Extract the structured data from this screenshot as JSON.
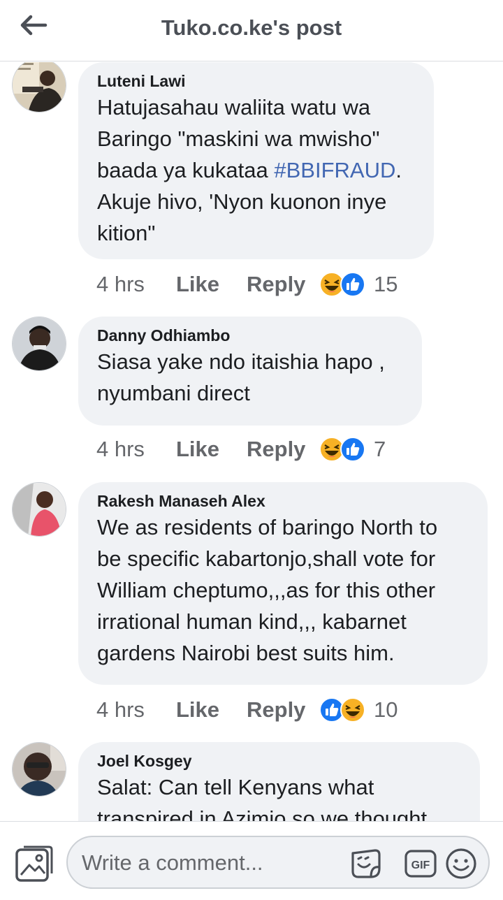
{
  "header": {
    "title": "Tuko.co.ke's post"
  },
  "comments": [
    {
      "author": "Luteni Lawi",
      "text_before": "Hatujasahau waliita watu wa\nBaringo \"maskini wa mwisho\"\nbaada ya kukataa ",
      "hashtag": "#BBIFRAUD",
      "text_after": ".\nAkuje hivo, 'Nyon kuonon inye\nkition\"",
      "time": "4 hrs",
      "like_label": "Like",
      "reply_label": "Reply",
      "reactions": [
        "haha",
        "like"
      ],
      "reaction_count": "15"
    },
    {
      "author": "Danny Odhiambo",
      "text": "Siasa yake ndo itaishia hapo ,\nnyumbani direct",
      "time": "4 hrs",
      "like_label": "Like",
      "reply_label": "Reply",
      "reactions": [
        "haha",
        "like"
      ],
      "reaction_count": "7"
    },
    {
      "author": "Rakesh Manaseh Alex",
      "text": "We as residents of baringo North to\nbe specific kabartonjo,shall vote for\nWilliam cheptumo,,,as for this other\nirrational human kind,,, kabarnet\ngardens Nairobi best suits him.",
      "time": "4 hrs",
      "like_label": "Like",
      "reply_label": "Reply",
      "reactions": [
        "like",
        "haha"
      ],
      "reaction_count": "10"
    },
    {
      "author": "Joel Kosgey",
      "text": "Salat: Can tell Kenyans what\ntranspired in Azimio so we thought",
      "time": "",
      "like_label": "",
      "reply_label": "",
      "reaction_count": ""
    }
  ],
  "composer": {
    "placeholder": "Write a comment..."
  },
  "icons": {
    "back": "arrow-left-icon",
    "photo": "photo-icon",
    "sticker": "sticker-icon",
    "gif": "gif-icon",
    "emoji": "emoji-icon",
    "reaction_like": "like-reaction-icon",
    "reaction_haha": "haha-reaction-icon"
  },
  "colors": {
    "accent_blue": "#1877f2",
    "hashtag": "#4267b2",
    "bubble_bg": "#f0f2f5",
    "meta_text": "#65676b"
  }
}
